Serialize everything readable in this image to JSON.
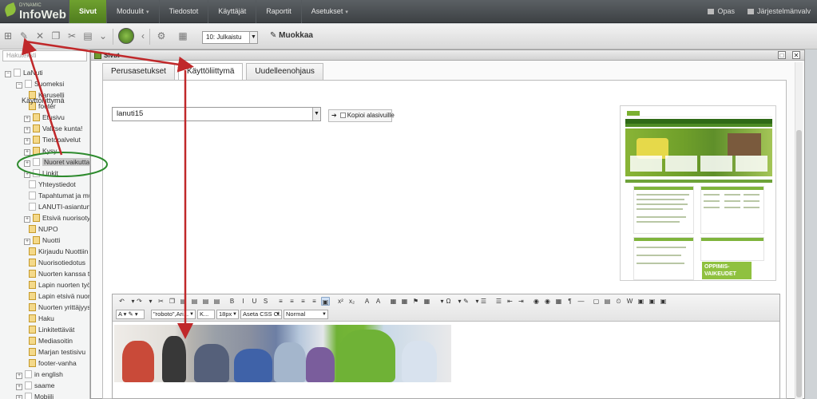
{
  "app": {
    "logo_small": "DYNAMIC",
    "logo_big": "InfoWeb"
  },
  "nav": [
    {
      "label": "Sivut",
      "active": true
    },
    {
      "label": "Moduulit",
      "chevron": true
    },
    {
      "label": "Tiedostot"
    },
    {
      "label": "Käyttäjät"
    },
    {
      "label": "Raportit"
    },
    {
      "label": "Asetukset",
      "chevron": true
    }
  ],
  "topright": {
    "help": "Opas",
    "user": "Järjestelmänvalv"
  },
  "toolbar": {
    "status_select": "10: Julkaistu",
    "edit_label": "Muokkaa",
    "icons": [
      "add-icon",
      "edit-icon",
      "delete-icon",
      "copy-icon",
      "cut-icon",
      "paste-icon",
      "chevron-down-icon",
      "globe-icon",
      "chevron-left-icon",
      "settings-icon",
      "page-settings-icon"
    ]
  },
  "sidebar": {
    "search_placeholder": "Hakuteksti",
    "items": [
      {
        "label": "LaNuti",
        "type": "root"
      },
      {
        "label": "Suomeksi",
        "type": "page"
      },
      {
        "label": "Karuselli",
        "type": "fav"
      },
      {
        "label": "footer",
        "type": "fav"
      },
      {
        "label": "Etusivu",
        "type": "fav"
      },
      {
        "label": "Valitse kunta!",
        "type": "fav"
      },
      {
        "label": "Tietopalvelut",
        "type": "fav"
      },
      {
        "label": "Kysy",
        "type": "fav"
      },
      {
        "label": "Nuoret vaikuttajat",
        "type": "page",
        "selected": true
      },
      {
        "label": "Linkit",
        "type": "page"
      },
      {
        "label": "Yhteystiedot",
        "type": "page"
      },
      {
        "label": "Tapahtumat ja muu",
        "type": "page"
      },
      {
        "label": "LANUTI-asiantuntij",
        "type": "page"
      },
      {
        "label": "Etsivä nuorisotyö",
        "type": "fav"
      },
      {
        "label": "NUPO",
        "type": "fav"
      },
      {
        "label": "Nuotti",
        "type": "fav"
      },
      {
        "label": "Kirjaudu Nuottiin",
        "type": "fav"
      },
      {
        "label": "Nuorisotiedotus",
        "type": "fav"
      },
      {
        "label": "Nuorten kanssa työ",
        "type": "fav"
      },
      {
        "label": "Lapin nuorten työp",
        "type": "fav"
      },
      {
        "label": "Lapin etsivä nuoriso",
        "type": "fav"
      },
      {
        "label": "Nuorten yrittäjyys",
        "type": "fav"
      },
      {
        "label": "Haku",
        "type": "fav"
      },
      {
        "label": "Linkitettävät",
        "type": "fav"
      },
      {
        "label": "Mediasoitin",
        "type": "fav"
      },
      {
        "label": "Marjan testisivu",
        "type": "fav"
      },
      {
        "label": "footer-vanha",
        "type": "fav"
      },
      {
        "label": "in english",
        "type": "page"
      },
      {
        "label": "saame",
        "type": "page"
      },
      {
        "label": "Mobiili",
        "type": "page"
      }
    ]
  },
  "dialog": {
    "title": "Sivut",
    "tabs": [
      {
        "label": "Perusasetukset"
      },
      {
        "label": "Käyttöliittymä",
        "active": true
      },
      {
        "label": "Uudelleenohjaus"
      }
    ],
    "field_label": "Käyttöliittymä",
    "theme_value": "lanuti15",
    "copy_label": "Kopioi alasivuille",
    "preview_badge": "OPPIMIS-VAIKEUDET"
  },
  "editor": {
    "font_family": "\"roboto\",Ari...",
    "format_k": "K...",
    "font_size": "18px",
    "css_class": "Aseta CSS Cl...",
    "block_format": "Normal"
  },
  "colors": {
    "nav_active": "#5f8f25",
    "annotation_arrow": "#c0282a",
    "annotation_circle": "#2e8b2e"
  }
}
